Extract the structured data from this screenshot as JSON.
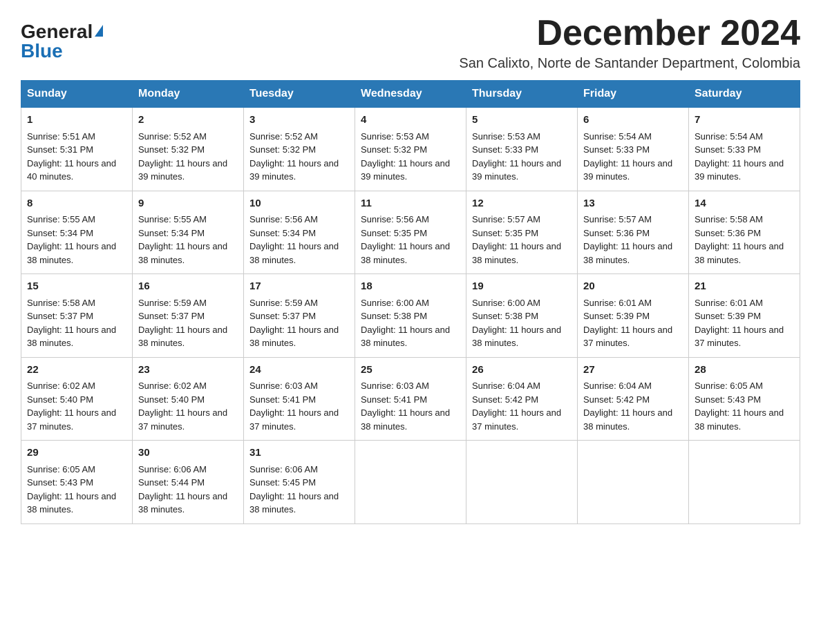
{
  "logo": {
    "general": "General",
    "blue": "Blue",
    "triangle": "▶"
  },
  "title": "December 2024",
  "subtitle": "San Calixto, Norte de Santander Department, Colombia",
  "days_of_week": [
    "Sunday",
    "Monday",
    "Tuesday",
    "Wednesday",
    "Thursday",
    "Friday",
    "Saturday"
  ],
  "weeks": [
    [
      {
        "day": "1",
        "sunrise": "5:51 AM",
        "sunset": "5:31 PM",
        "daylight": "11 hours and 40 minutes."
      },
      {
        "day": "2",
        "sunrise": "5:52 AM",
        "sunset": "5:32 PM",
        "daylight": "11 hours and 39 minutes."
      },
      {
        "day": "3",
        "sunrise": "5:52 AM",
        "sunset": "5:32 PM",
        "daylight": "11 hours and 39 minutes."
      },
      {
        "day": "4",
        "sunrise": "5:53 AM",
        "sunset": "5:32 PM",
        "daylight": "11 hours and 39 minutes."
      },
      {
        "day": "5",
        "sunrise": "5:53 AM",
        "sunset": "5:33 PM",
        "daylight": "11 hours and 39 minutes."
      },
      {
        "day": "6",
        "sunrise": "5:54 AM",
        "sunset": "5:33 PM",
        "daylight": "11 hours and 39 minutes."
      },
      {
        "day": "7",
        "sunrise": "5:54 AM",
        "sunset": "5:33 PM",
        "daylight": "11 hours and 39 minutes."
      }
    ],
    [
      {
        "day": "8",
        "sunrise": "5:55 AM",
        "sunset": "5:34 PM",
        "daylight": "11 hours and 38 minutes."
      },
      {
        "day": "9",
        "sunrise": "5:55 AM",
        "sunset": "5:34 PM",
        "daylight": "11 hours and 38 minutes."
      },
      {
        "day": "10",
        "sunrise": "5:56 AM",
        "sunset": "5:34 PM",
        "daylight": "11 hours and 38 minutes."
      },
      {
        "day": "11",
        "sunrise": "5:56 AM",
        "sunset": "5:35 PM",
        "daylight": "11 hours and 38 minutes."
      },
      {
        "day": "12",
        "sunrise": "5:57 AM",
        "sunset": "5:35 PM",
        "daylight": "11 hours and 38 minutes."
      },
      {
        "day": "13",
        "sunrise": "5:57 AM",
        "sunset": "5:36 PM",
        "daylight": "11 hours and 38 minutes."
      },
      {
        "day": "14",
        "sunrise": "5:58 AM",
        "sunset": "5:36 PM",
        "daylight": "11 hours and 38 minutes."
      }
    ],
    [
      {
        "day": "15",
        "sunrise": "5:58 AM",
        "sunset": "5:37 PM",
        "daylight": "11 hours and 38 minutes."
      },
      {
        "day": "16",
        "sunrise": "5:59 AM",
        "sunset": "5:37 PM",
        "daylight": "11 hours and 38 minutes."
      },
      {
        "day": "17",
        "sunrise": "5:59 AM",
        "sunset": "5:37 PM",
        "daylight": "11 hours and 38 minutes."
      },
      {
        "day": "18",
        "sunrise": "6:00 AM",
        "sunset": "5:38 PM",
        "daylight": "11 hours and 38 minutes."
      },
      {
        "day": "19",
        "sunrise": "6:00 AM",
        "sunset": "5:38 PM",
        "daylight": "11 hours and 38 minutes."
      },
      {
        "day": "20",
        "sunrise": "6:01 AM",
        "sunset": "5:39 PM",
        "daylight": "11 hours and 37 minutes."
      },
      {
        "day": "21",
        "sunrise": "6:01 AM",
        "sunset": "5:39 PM",
        "daylight": "11 hours and 37 minutes."
      }
    ],
    [
      {
        "day": "22",
        "sunrise": "6:02 AM",
        "sunset": "5:40 PM",
        "daylight": "11 hours and 37 minutes."
      },
      {
        "day": "23",
        "sunrise": "6:02 AM",
        "sunset": "5:40 PM",
        "daylight": "11 hours and 37 minutes."
      },
      {
        "day": "24",
        "sunrise": "6:03 AM",
        "sunset": "5:41 PM",
        "daylight": "11 hours and 37 minutes."
      },
      {
        "day": "25",
        "sunrise": "6:03 AM",
        "sunset": "5:41 PM",
        "daylight": "11 hours and 38 minutes."
      },
      {
        "day": "26",
        "sunrise": "6:04 AM",
        "sunset": "5:42 PM",
        "daylight": "11 hours and 37 minutes."
      },
      {
        "day": "27",
        "sunrise": "6:04 AM",
        "sunset": "5:42 PM",
        "daylight": "11 hours and 38 minutes."
      },
      {
        "day": "28",
        "sunrise": "6:05 AM",
        "sunset": "5:43 PM",
        "daylight": "11 hours and 38 minutes."
      }
    ],
    [
      {
        "day": "29",
        "sunrise": "6:05 AM",
        "sunset": "5:43 PM",
        "daylight": "11 hours and 38 minutes."
      },
      {
        "day": "30",
        "sunrise": "6:06 AM",
        "sunset": "5:44 PM",
        "daylight": "11 hours and 38 minutes."
      },
      {
        "day": "31",
        "sunrise": "6:06 AM",
        "sunset": "5:45 PM",
        "daylight": "11 hours and 38 minutes."
      },
      null,
      null,
      null,
      null
    ]
  ],
  "labels": {
    "sunrise": "Sunrise:",
    "sunset": "Sunset:",
    "daylight": "Daylight:"
  },
  "colors": {
    "header_bg": "#2a78b5",
    "header_text": "#ffffff",
    "border": "#cccccc"
  }
}
